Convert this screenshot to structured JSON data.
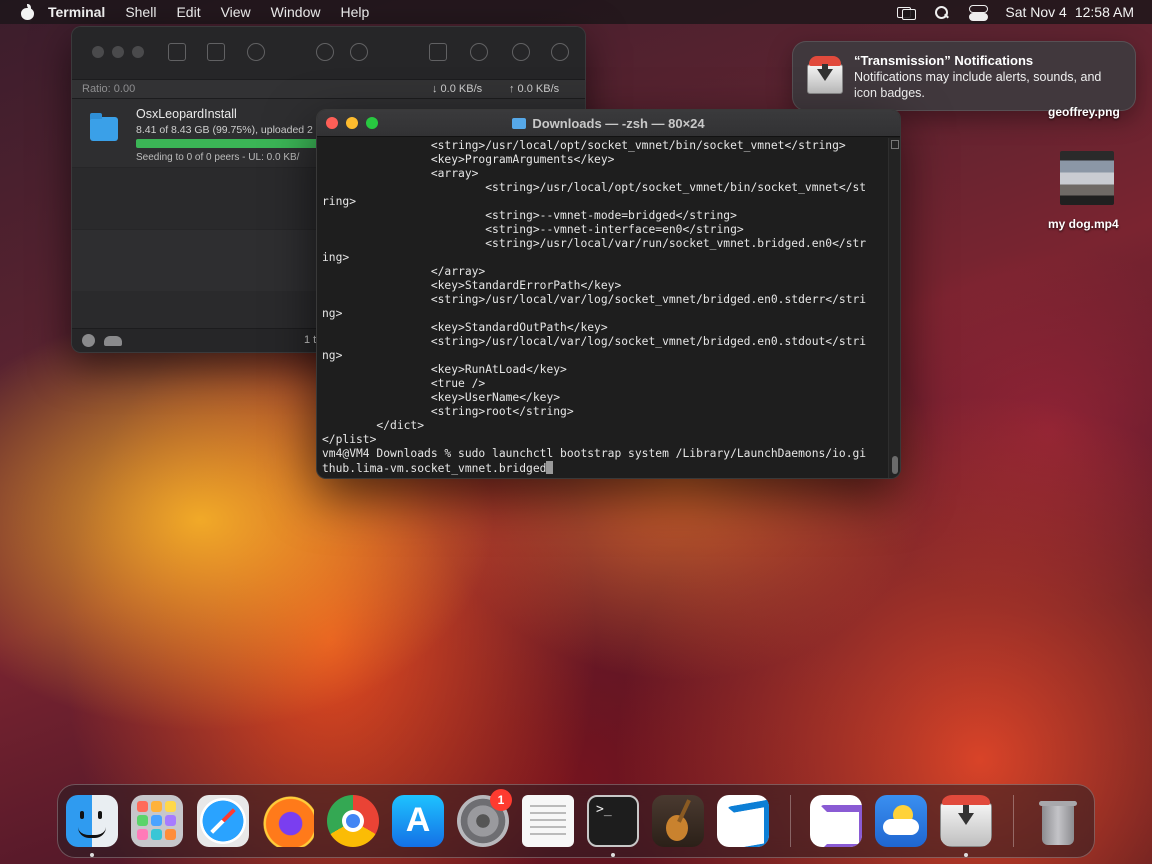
{
  "menubar": {
    "app_name": "Terminal",
    "items": [
      "Shell",
      "Edit",
      "View",
      "Window",
      "Help"
    ],
    "date": "Sat Nov 4",
    "time": "12:58 AM"
  },
  "transmission": {
    "ratio": "Ratio: 0.00",
    "download_rate": "↓ 0.0 KB/s",
    "upload_rate": "↑ 0.0 KB/s",
    "torrent": {
      "name": "OsxLeopardInstall",
      "info": "8.41 of 8.43 GB (99.75%), uploaded 2",
      "progress": 0.9975,
      "status": "Seeding to 0 of 0 peers - UL: 0.0 KB/"
    },
    "bottom_count": "1 t"
  },
  "terminal": {
    "title": "Downloads — -zsh — 80×24",
    "lines": [
      "                <string>/usr/local/opt/socket_vmnet/bin/socket_vmnet</string>",
      "                <key>ProgramArguments</key>",
      "                <array>",
      "                        <string>/usr/local/opt/socket_vmnet/bin/socket_vmnet</st",
      "ring>",
      "                        <string>--vmnet-mode=bridged</string>",
      "                        <string>--vmnet-interface=en0</string>",
      "                        <string>/usr/local/var/run/socket_vmnet.bridged.en0</str",
      "ing>",
      "                </array>",
      "                <key>StandardErrorPath</key>",
      "                <string>/usr/local/var/log/socket_vmnet/bridged.en0.stderr</stri",
      "ng>",
      "                <key>StandardOutPath</key>",
      "                <string>/usr/local/var/log/socket_vmnet/bridged.en0.stdout</stri",
      "ng>",
      "                <key>RunAtLoad</key>",
      "                <true />",
      "                <key>UserName</key>",
      "                <string>root</string>",
      "        </dict>",
      "</plist>",
      "vm4@VM4 Downloads % sudo launchctl bootstrap system /Library/LaunchDaemons/io.gi"
    ],
    "prompt_line": "thub.lima-vm.socket_vmnet.bridged"
  },
  "notification": {
    "title": "“Transmission” Notifications",
    "body": "Notifications may include alerts, sounds, and icon badges."
  },
  "desktop": {
    "file1": "geoffrey.png",
    "file2": "my dog.mp4"
  },
  "dock": {
    "apps": [
      "Finder",
      "Launchpad",
      "Safari",
      "Firefox",
      "Google Chrome",
      "App Store",
      "System Settings",
      "TextEdit",
      "Terminal",
      "GarageBand",
      "Visual Studio Code",
      "Visual Studio",
      "Weather",
      "Transmission",
      "Trash"
    ],
    "settings_badge": "1"
  }
}
